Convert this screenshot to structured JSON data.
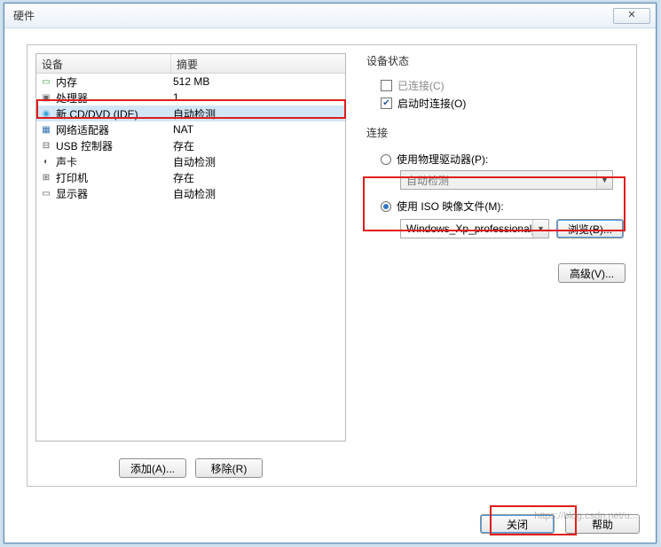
{
  "window": {
    "title": "硬件",
    "close_glyph": "✕"
  },
  "device_list": {
    "header": {
      "device": "设备",
      "summary": "摘要"
    },
    "rows": [
      {
        "icon": "memory-icon",
        "icon_glyph": "▭",
        "icon_color": "#3b9b3b",
        "name": "内存",
        "summary": "512 MB"
      },
      {
        "icon": "cpu-icon",
        "icon_glyph": "▣",
        "icon_color": "#6a6a6a",
        "name": "处理器",
        "summary": "1"
      },
      {
        "icon": "disc-icon",
        "icon_glyph": "◉",
        "icon_color": "#3ba4db",
        "name": "新 CD/DVD (IDE)",
        "summary": "自动检测"
      },
      {
        "icon": "network-icon",
        "icon_glyph": "▦",
        "icon_color": "#2f6fb0",
        "name": "网络适配器",
        "summary": "NAT"
      },
      {
        "icon": "usb-icon",
        "icon_glyph": "⊟",
        "icon_color": "#555",
        "name": "USB 控制器",
        "summary": "存在"
      },
      {
        "icon": "sound-icon",
        "icon_glyph": "◐",
        "icon_color": "#555",
        "name": "声卡",
        "summary": "自动检测"
      },
      {
        "icon": "printer-icon",
        "icon_glyph": "⊞",
        "icon_color": "#555",
        "name": "打印机",
        "summary": "存在"
      },
      {
        "icon": "display-icon",
        "icon_glyph": "▭",
        "icon_color": "#555",
        "name": "显示器",
        "summary": "自动检测"
      }
    ],
    "selected_index": 2,
    "add_button": "添加(A)...",
    "remove_button": "移除(R)"
  },
  "status": {
    "group_label": "设备状态",
    "connected": {
      "label": "已连接(C)",
      "checked": false,
      "enabled": false
    },
    "connect_on_start": {
      "label": "启动时连接(O)",
      "checked": true
    }
  },
  "connection": {
    "group_label": "连接",
    "physical": {
      "label": "使用物理驱动器(P):",
      "selected": false
    },
    "physical_value": "自动检测",
    "iso": {
      "label": "使用 ISO 映像文件(M):",
      "selected": true
    },
    "iso_value": "Windows_Xp_professional_v",
    "browse_button": "浏览(B)..."
  },
  "advanced_button": "高级(V)...",
  "footer": {
    "close": "关闭",
    "help": "帮助"
  },
  "watermark": "https://blog.csdn.net/u..."
}
